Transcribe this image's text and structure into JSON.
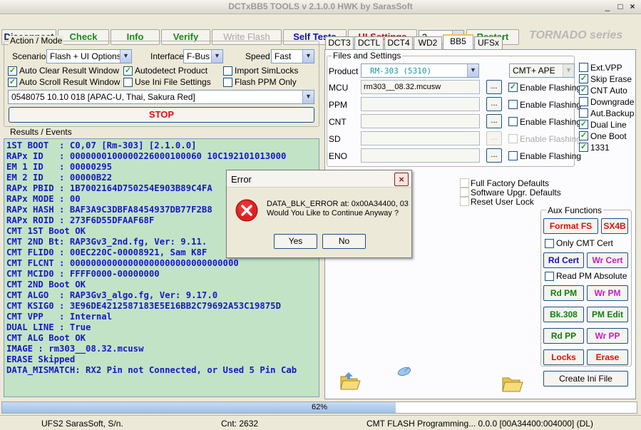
{
  "window": {
    "title": "DCTxBB5 TOOLS v 2.1.0.0 HWK by SarasSoft",
    "controls": [
      "_",
      "□",
      "×"
    ]
  },
  "toolbar": {
    "disconnect": "Disconnect",
    "check": "Check",
    "info": "Info",
    "verify": "Verify",
    "write_flash": "Write Flash",
    "self_tests": "Self Tests",
    "ui_settings": "UI Settings",
    "combo_value": "?",
    "restart": "Restart",
    "series": "TORNADO series",
    "colors": {
      "green": "#1a8a1a",
      "blue": "#1010b0",
      "red": "#c81010",
      "disabled": "#a8a8a8"
    }
  },
  "mode": {
    "title": "Action / Mode",
    "scenario_label": "Scenario",
    "scenario_value": "Flash + UI Options",
    "interface_label": "Interface",
    "interface_value": "F-Bus",
    "speed_label": "Speed",
    "speed_value": "Fast",
    "auto_clear": "Auto Clear Result Window",
    "autodetect": "Autodetect Product",
    "import_simlocks": "Import SimLocks",
    "auto_scroll": "Auto Scroll Result Window",
    "use_ini": "Use Ini File Settings",
    "flash_ppm": "Flash PPM Only",
    "product_value": "0548075 10.10 018  [APAC-U, Thai, Sakura Red]",
    "stop": "STOP"
  },
  "results": {
    "title": "Results / Events",
    "lines": [
      "1ST BOOT  : C0,07 [Rm-303] [2.1.0.0]",
      "RAPx ID   : 0000000100000226000100060 10C192101013000",
      "EM 1 ID   : 00000295",
      "EM 2 ID   : 00000B22",
      "RAPx PBID : 1B7002164D750254E903B89C4FA",
      "RAPx MODE : 00",
      "RAPx HASH : BAF3A9C3DBFA8454937DB77F2B8",
      "RAPx ROID : 273F6D55DFAAF68F",
      "CMT 1ST Boot OK",
      "CMT 2ND Bt: RAP3Gv3_2nd.fg, Ver: 9.11.",
      "CMT FLID0 : 00EC220C-00008921, Sam K8F",
      "CMT FLCNT : 00000000000000000000000000000000",
      "CMT MCID0 : FFFF0000-00000000",
      "CMT 2ND Boot OK",
      "CMT ALGO  : RAP3Gv3_algo.fg, Ver: 9.17.0",
      "CMT KSIG0 : 3E96DE4212587183E5E16BB2C79692A53C19875D",
      "CMT VPP   : Internal",
      "DUAL LINE : True",
      "CMT ALG Boot OK",
      "IMAGE : rm303__08.32.mcusw",
      "ERASE Skipped",
      "DATA_MISMATCH: RX2 Pin not Connected, or Used 5 Pin Cab"
    ]
  },
  "tabs": [
    "DCT3",
    "DCTL",
    "DCT4",
    "WD2",
    "BB5",
    "UFSx"
  ],
  "active_tab": "BB5",
  "files": {
    "title": "Files and Settings",
    "product_label": "Product",
    "product_value": "RM-303 (5310)",
    "mode_value": "CMT+ APE",
    "rows": [
      {
        "label": "MCU",
        "value": "rm303__08.32.mcusw",
        "enable": "Enable Flashing",
        "checked": true
      },
      {
        "label": "PPM",
        "value": "",
        "enable": "Enable Flashing",
        "checked": false
      },
      {
        "label": "CNT",
        "value": "",
        "enable": "Enable Flashing",
        "checked": false
      },
      {
        "label": "SD",
        "value": "",
        "enable": "Enable Flashing",
        "checked": false
      },
      {
        "label": "ENO",
        "value": "",
        "enable": "Enable Flashing",
        "checked": false
      }
    ],
    "browse": "...",
    "options": [
      {
        "label": "Ext.VPP",
        "checked": false
      },
      {
        "label": "Skip Erase",
        "checked": true
      },
      {
        "label": "CNT Auto",
        "checked": true
      },
      {
        "label": "Downgrade",
        "checked": false
      },
      {
        "label": "Aut.Backup",
        "checked": false
      },
      {
        "label": "Dual Line",
        "checked": true
      },
      {
        "label": "One Boot",
        "checked": true
      },
      {
        "label": "1331",
        "checked": true
      }
    ]
  },
  "defaults": {
    "factory": "Full Factory Defaults",
    "software_upgr": "Software Upgr. Defaults",
    "reset_user_lock": "Reset User Lock"
  },
  "aux": {
    "title": "Aux Functions",
    "format_fs": "Format FS",
    "sx4b": "SX4B",
    "only_cmt_cert": "Only CMT Cert",
    "rd_cert": "Rd Cert",
    "wr_cert": "Wr Cert",
    "read_pm_absolute": "Read PM Absolute",
    "rd_pm": "Rd PM",
    "wr_pm": "Wr PM",
    "bk308": "Bk.308",
    "pm_edit": "PM Edit",
    "rd_pp": "Rd PP",
    "wr_pp": "Wr PP",
    "locks": "Locks",
    "erase": "Erase",
    "create_ini": "Create Ini File",
    "colors": {
      "red": "#e01010",
      "blue": "#1010c0",
      "green": "#108010",
      "magenta": "#c020c0"
    }
  },
  "icons": [
    "folder-open-icon",
    "satellite-dish-icon",
    "folder-icon",
    "error-icon"
  ],
  "progress": {
    "percent": 62,
    "label": "62%"
  },
  "status": {
    "left": "UFS2 SarasSoft, S/n.",
    "cnt": "Cnt: 2632",
    "message": "CMT FLASH Programming... 0.0.0 [00A34400:004000] (DL)"
  },
  "dialog": {
    "title": "Error",
    "line1": "DATA_BLK_ERROR at: 0x00A34400, 03",
    "line2": "Would You Like to Continue Anyway ?",
    "yes": "Yes",
    "no": "No",
    "close": "×"
  }
}
